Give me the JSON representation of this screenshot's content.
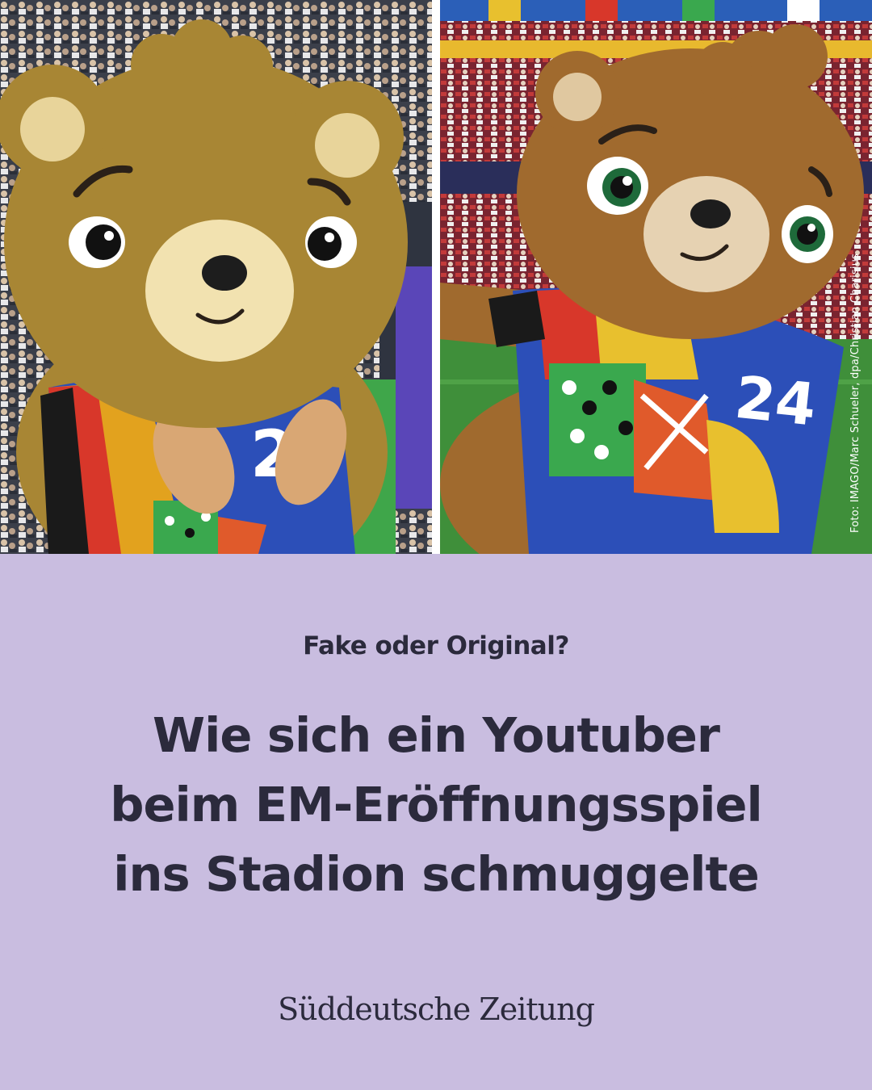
{
  "photo": {
    "credit": "Foto: IMAGO/Marc Schueler, dpa/Christian Charisius",
    "left_jersey_number": "2",
    "right_jersey_number": "24"
  },
  "article": {
    "kicker": "Fake oder Original?",
    "headline_lines": [
      "Wie sich ein Youtuber",
      "beim EM-Eröffnungsspiel",
      "ins Stadion schmuggelte"
    ]
  },
  "brand": {
    "logo_text": "Süddeutsche Zeitung"
  },
  "colors": {
    "background": "#c9bde0",
    "text": "#2b2a3c",
    "fur": "#a88634",
    "muzzle": "#f2e2b0"
  }
}
